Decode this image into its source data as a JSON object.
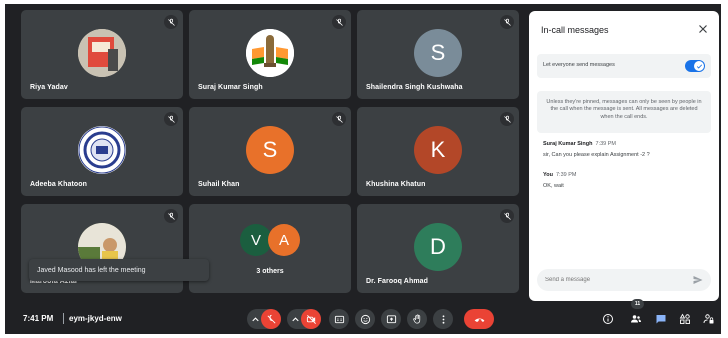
{
  "participants": [
    {
      "name": "Riya Yadav",
      "type": "photo"
    },
    {
      "name": "Suraj Kumar Singh",
      "type": "emblem"
    },
    {
      "name": "Shailendra Singh Kushwaha",
      "type": "letter",
      "letter": "S",
      "color": "#7a8c99"
    },
    {
      "name": "Adeeba Khatoon",
      "type": "seal"
    },
    {
      "name": "Suhail Khan",
      "type": "letter",
      "letter": "S",
      "color": "#e8712a"
    },
    {
      "name": "Khushina Khatun",
      "type": "letter",
      "letter": "K",
      "color": "#b34728"
    },
    {
      "name": "Maroofa Azfar",
      "type": "photo"
    },
    {
      "name": "Dr. Farooq Ahmad",
      "type": "letter",
      "letter": "D",
      "color": "#2e7d5b"
    }
  ],
  "others": {
    "label": "3 others",
    "avatars": [
      {
        "letter": "V",
        "color": "#1b5e3f"
      },
      {
        "letter": "A",
        "color": "#e8712a"
      }
    ]
  },
  "toast": "Javed Masood has left the meeting",
  "chat": {
    "title": "In-call messages",
    "toggle_label": "Let everyone send messages",
    "toggle_on": true,
    "notice": "Unless they're pinned, messages can only be seen by people in the call when the message is sent. All messages are deleted when the call ends.",
    "messages": [
      {
        "sender": "Suraj Kumar Singh",
        "time": "7:39 PM",
        "text": "sir, Can you please explain Assignment -2 ?"
      },
      {
        "sender": "You",
        "time": "7:39 PM",
        "text": "OK, wait"
      }
    ],
    "input_placeholder": "Send a message"
  },
  "bottom_bar": {
    "time": "7:41 PM",
    "meeting_code": "eym-jkyd-enw",
    "participant_count": "11"
  },
  "colors": {
    "background": "#202124",
    "tile": "#3c4043",
    "accent": "#1a73e8",
    "danger": "#ea4335"
  }
}
